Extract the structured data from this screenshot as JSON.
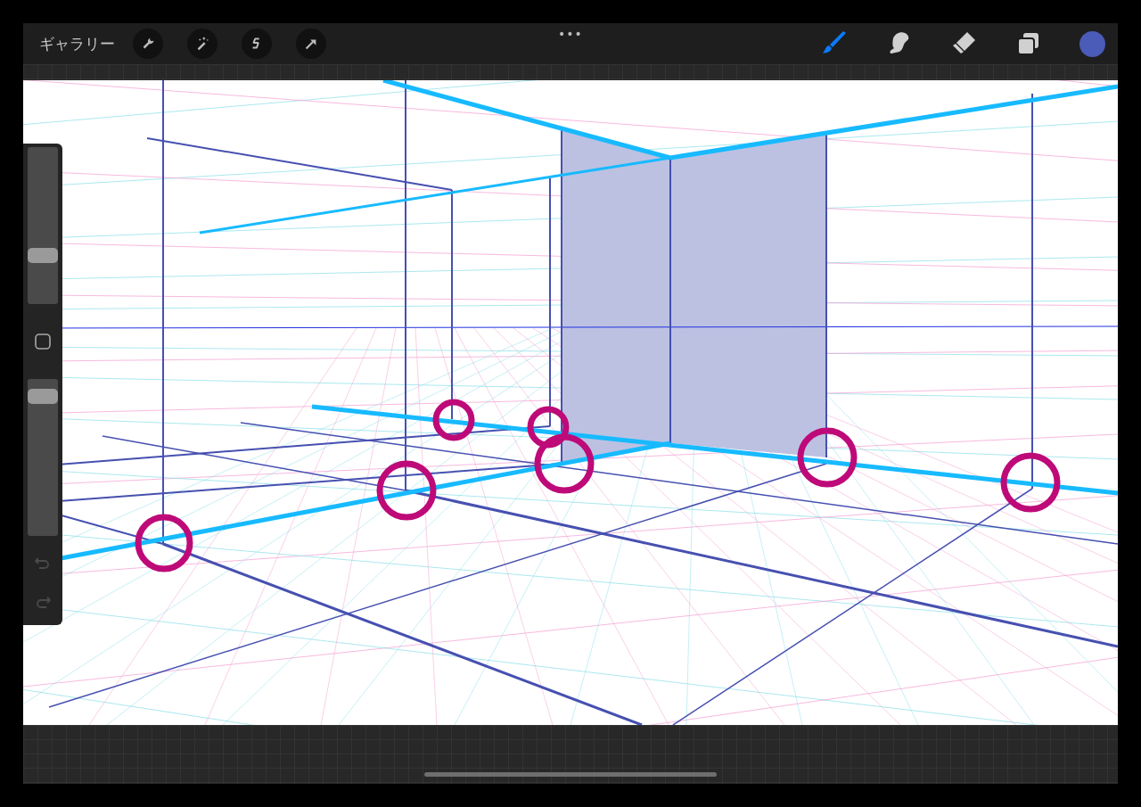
{
  "top_bar": {
    "gallery": "ギャラリー",
    "actions": [
      {
        "kind": "wrench"
      },
      {
        "kind": "wand"
      },
      {
        "kind": "selection"
      },
      {
        "kind": "transform"
      }
    ],
    "more": "•••",
    "tools": [
      {
        "kind": "brush",
        "selected": true
      },
      {
        "kind": "smudge",
        "selected": false
      },
      {
        "kind": "eraser",
        "selected": false
      },
      {
        "kind": "layers",
        "selected": false
      }
    ],
    "color": {
      "color": "#4a5bb8"
    }
  },
  "sidebar": {
    "size_slider": {
      "level": 0.29
    },
    "opacity_slider": {
      "level": 0.93
    },
    "undo": {
      "disabled": true
    },
    "redo": {
      "disabled": true
    }
  }
}
